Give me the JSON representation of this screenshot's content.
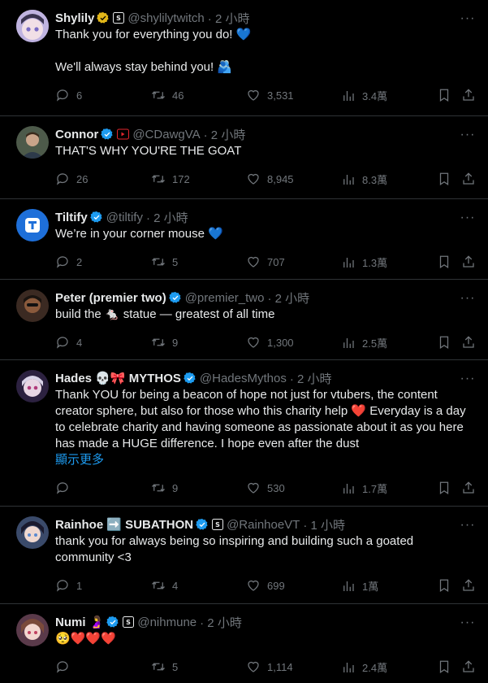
{
  "tweets": [
    {
      "name": "Shylily",
      "handle": "@shylilytwitch",
      "time": "· 2 小時",
      "text": "Thank you for everything you do! 💙\n\nWe'll always stay behind you! 🫂",
      "replies": "6",
      "retweets": "46",
      "likes": "3,531",
      "views": "3.4萬",
      "verified": "gold",
      "badge": "sub-badge"
    },
    {
      "name": "Connor",
      "handle": "@CDawgVA",
      "time": "· 2 小時",
      "text": "THAT'S WHY YOU'RE THE GOAT",
      "replies": "26",
      "retweets": "172",
      "likes": "8,945",
      "views": "8.3萬",
      "verified": "blue",
      "badge": "youtube-badge"
    },
    {
      "name": "Tiltify",
      "handle": "@tiltify",
      "time": "· 2 小時",
      "text": "We’re in your corner mouse 💙",
      "replies": "2",
      "retweets": "5",
      "likes": "707",
      "views": "1.3萬",
      "verified": "blue"
    },
    {
      "name": "Peter (premier two)",
      "handle": "@premier_two",
      "time": "· 2 小時",
      "text": "build the 🐁 statue — greatest of all time",
      "replies": "4",
      "retweets": "9",
      "likes": "1,300",
      "views": "2.5萬",
      "verified": "blue"
    },
    {
      "name": "Hades 💀🎀 MYTHOS",
      "handle": "@HadesMythos",
      "time": "· 2 小時",
      "text": "Thank YOU for being a beacon of hope not just for vtubers, the content creator sphere, but also for those who this charity help ❤️ Everyday is a day to celebrate charity and having someone as passionate about it as you here has made a HUGE difference. I hope even after the dust",
      "show_more": "顯示更多",
      "replies": "",
      "retweets": "9",
      "likes": "530",
      "views": "1.7萬",
      "verified": "blue"
    },
    {
      "name": "Rainhoe ➡️ SUBATHON",
      "handle": "@RainhoeVT",
      "time": "· 1 小時",
      "text": "thank you for always being so inspiring and building such a goated community <3",
      "replies": "1",
      "retweets": "4",
      "likes": "699",
      "views": "1萬",
      "verified": "blue",
      "badge": "sub-badge"
    },
    {
      "name": "Numi 🤰",
      "handle": "@nihmune",
      "time": "· 2 小時",
      "text": "🥺❤️❤️❤️",
      "replies": "",
      "retweets": "5",
      "likes": "1,114",
      "views": "2.4萬",
      "verified": "blue",
      "badge": "sub-badge"
    }
  ],
  "colors": {
    "background": "#000000",
    "text": "#e7e9ea",
    "muted": "#71767b",
    "link": "#1d9bf0",
    "verified_blue": "#1d9bf0",
    "verified_gold": "#e2b719",
    "divider": "#2f3336"
  }
}
